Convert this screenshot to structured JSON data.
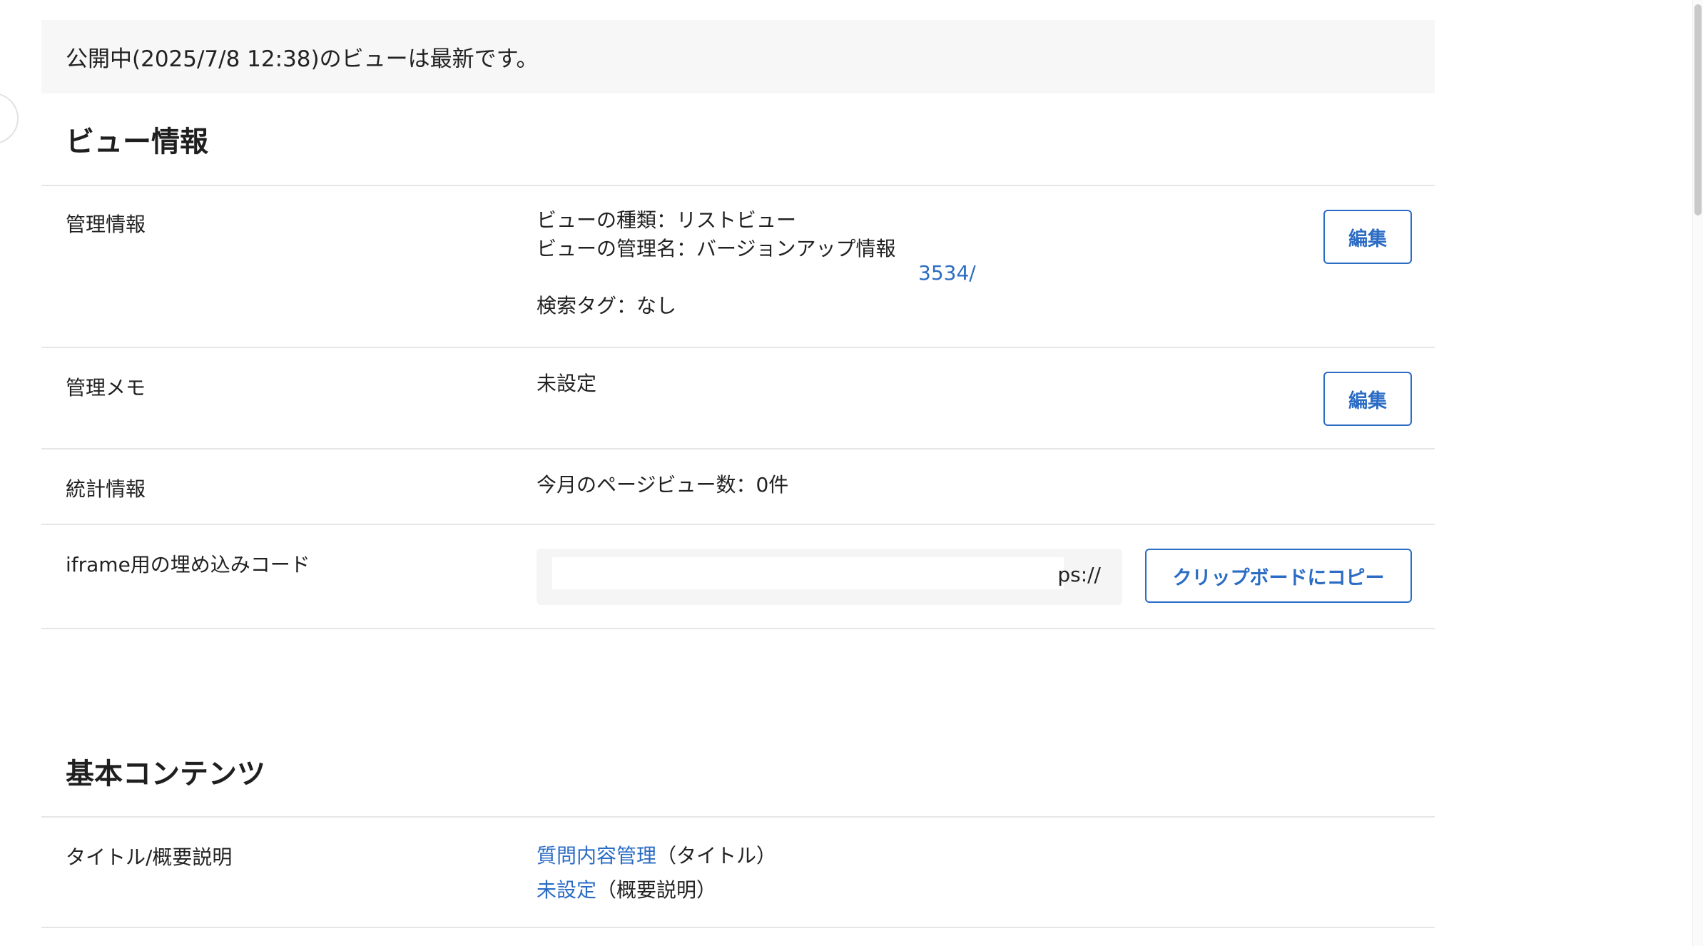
{
  "notice": {
    "text": "公開中(2025/7/8 12:38)のビューは最新です。"
  },
  "view_info": {
    "title": "ビュー情報",
    "management": {
      "label": "管理情報",
      "view_type": "ビューの種類：リストビュー",
      "admin_name": "ビューの管理名：バージョンアップ情報",
      "url_fragment": "3534/",
      "search_tags": "検索タグ：なし",
      "edit_label": "編集"
    },
    "memo": {
      "label": "管理メモ",
      "value": "未設定",
      "edit_label": "編集"
    },
    "stats": {
      "label": "統計情報",
      "value": "今月のページビュー数：0件"
    },
    "embed": {
      "label": "iframe用の埋め込みコード",
      "code_fragment": "ps://",
      "copy_label": "クリップボードにコピー"
    }
  },
  "basic_content": {
    "title": "基本コンテンツ",
    "title_desc": {
      "label": "タイトル/概要説明",
      "title_link": "質問内容管理",
      "title_suffix": "（タイトル）",
      "desc_link": "未設定",
      "desc_suffix": "（概要説明）"
    }
  }
}
